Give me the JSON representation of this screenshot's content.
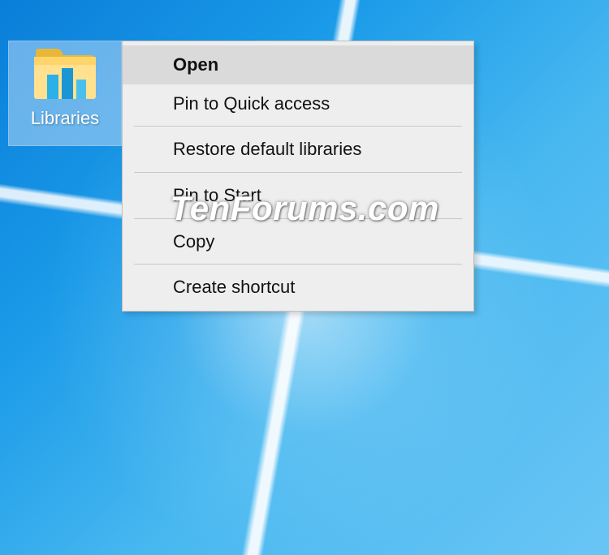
{
  "desktop": {
    "icon_label": "Libraries"
  },
  "context_menu": {
    "items": [
      {
        "label": "Open",
        "bold": true,
        "highlighted": true
      },
      {
        "label": "Pin to Quick access"
      },
      {
        "separator": true
      },
      {
        "label": "Restore default libraries"
      },
      {
        "separator": true
      },
      {
        "label": "Pin to Start"
      },
      {
        "separator": true
      },
      {
        "label": "Copy"
      },
      {
        "separator": true
      },
      {
        "label": "Create shortcut"
      }
    ]
  },
  "watermark": "TenForums.com"
}
